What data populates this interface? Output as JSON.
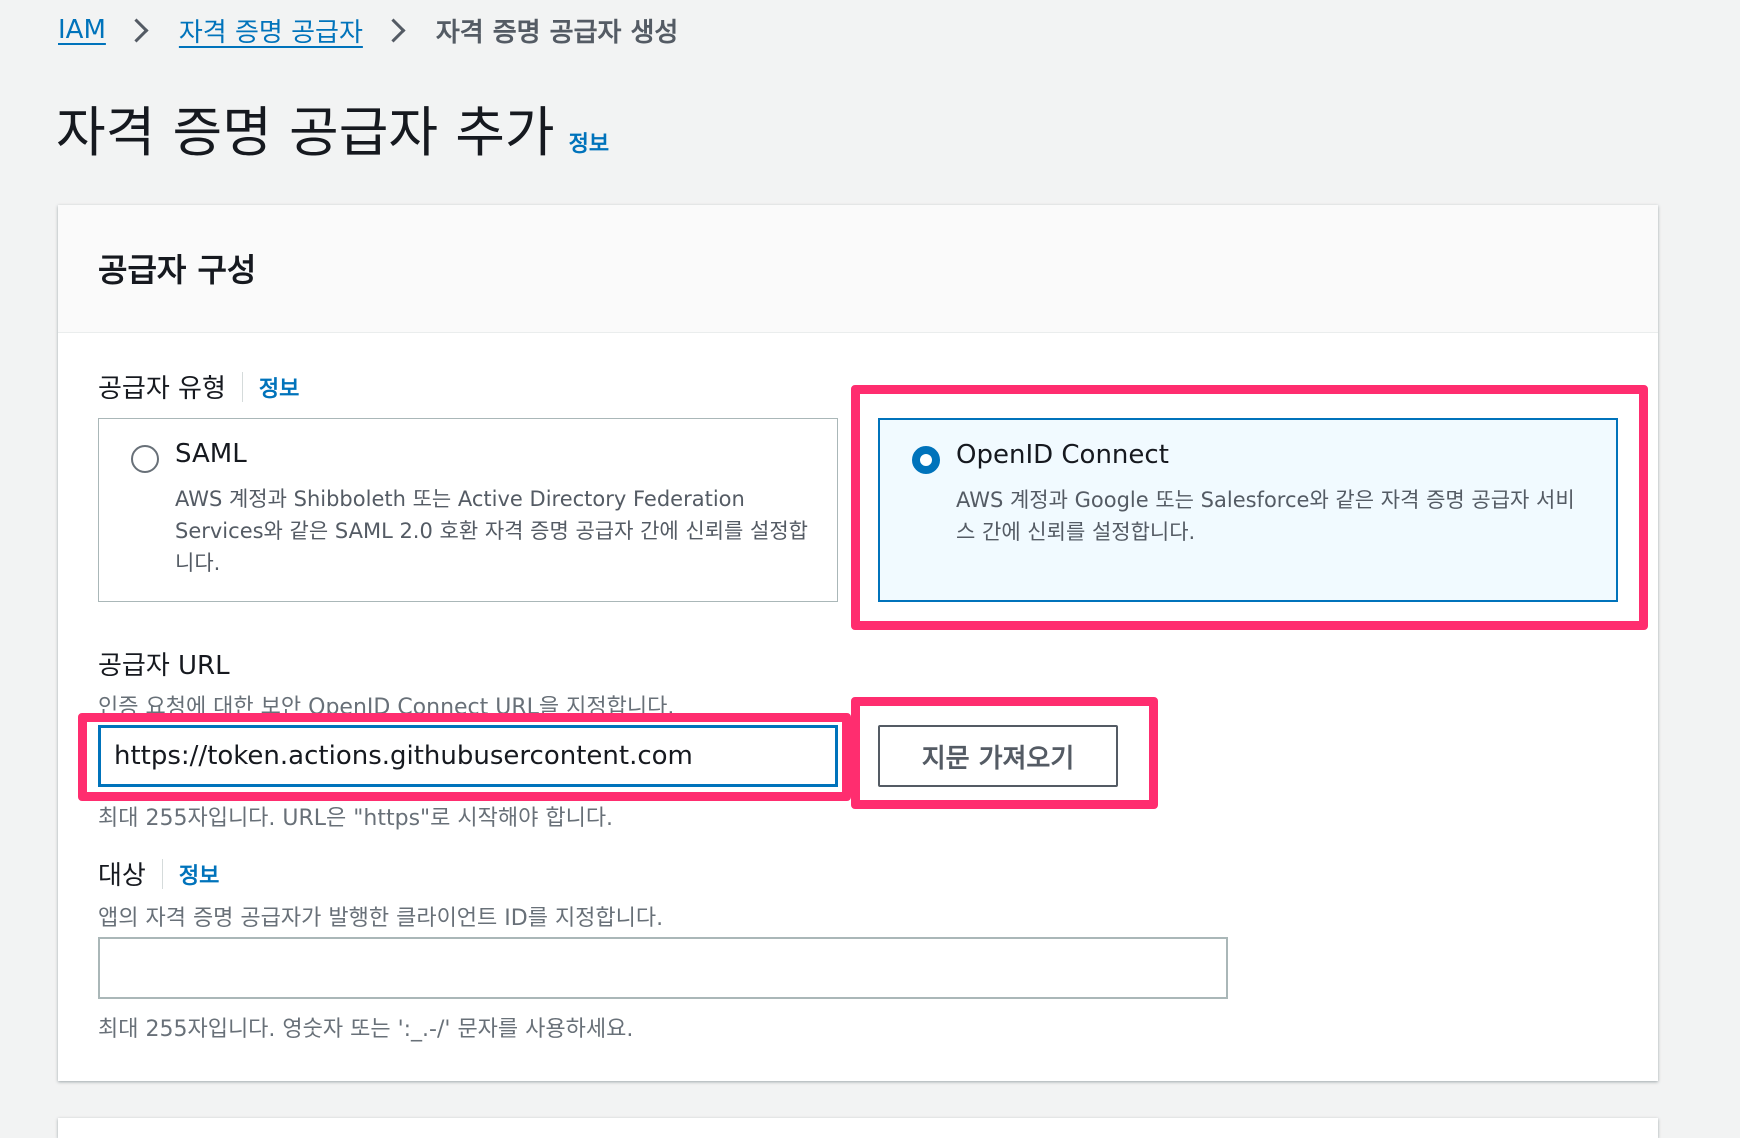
{
  "breadcrumb": {
    "items": [
      "IAM",
      "자격 증명 공급자"
    ],
    "current": "자격 증명 공급자 생성"
  },
  "page": {
    "title": "자격 증명 공급자 추가",
    "info": "정보"
  },
  "section": {
    "title": "공급자 구성"
  },
  "provider_type": {
    "label": "공급자 유형",
    "info": "정보",
    "options": [
      {
        "title": "SAML",
        "description": "AWS 계정과 Shibboleth 또는 Active Directory Federation Services와 같은 SAML 2.0 호환 자격 증명 공급자 간에 신뢰를 설정합니다.",
        "selected": false
      },
      {
        "title": "OpenID Connect",
        "description": "AWS 계정과 Google 또는 Salesforce와 같은 자격 증명 공급자 서비스 간에 신뢰를 설정합니다.",
        "selected": true
      }
    ]
  },
  "provider_url": {
    "label": "공급자 URL",
    "description": "인증 요청에 대한 보안 OpenID Connect URL을 지정합니다.",
    "value": "https://token.actions.githubusercontent.com",
    "button_label": "지문 가져오기",
    "constraint": "최대 255자입니다. URL은 \"https\"로 시작해야 합니다."
  },
  "audience": {
    "label": "대상",
    "info": "정보",
    "description": "앱의 자격 증명 공급자가 발행한 클라이언트 ID를 지정합니다.",
    "value": "",
    "constraint": "최대 255자입니다. 영숫자 또는 ':_.-/' 문자를 사용하세요."
  },
  "colors": {
    "link": "#0073bb",
    "highlight": "#ff2d6f",
    "selected_bg": "#f1faff"
  }
}
